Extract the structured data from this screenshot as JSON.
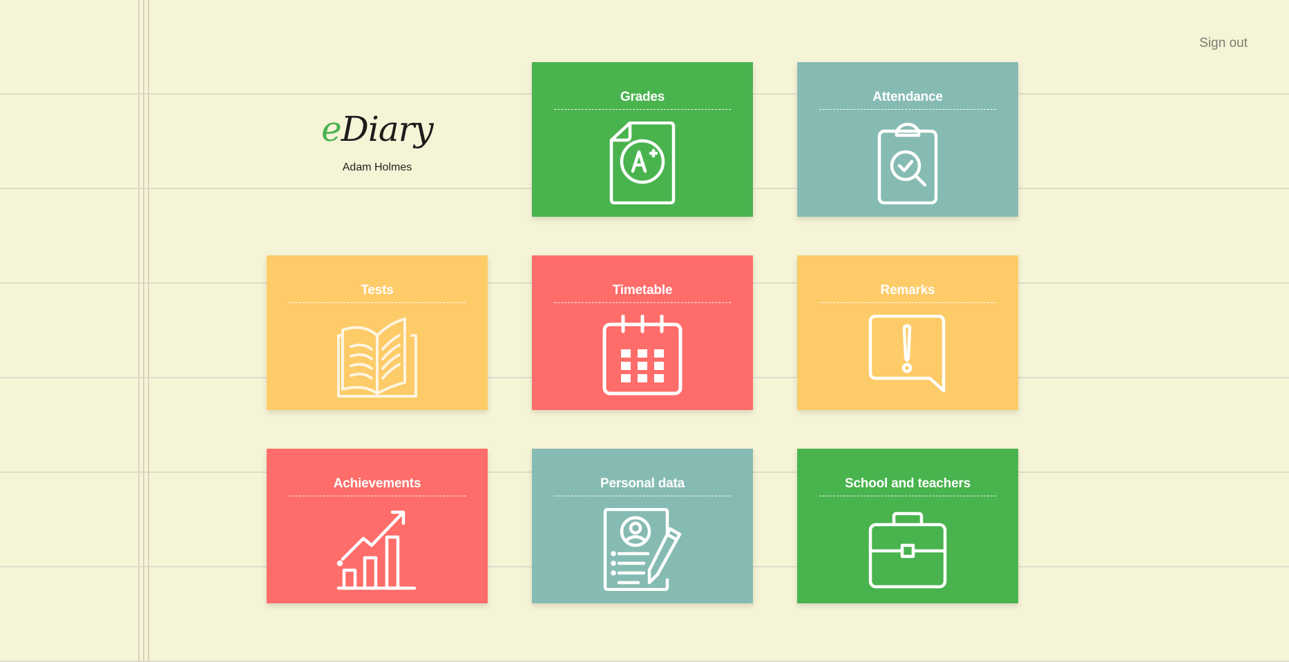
{
  "header": {
    "signout_label": "Sign out"
  },
  "brand": {
    "logo_e": "e",
    "logo_rest": "Diary",
    "user_name": "Adam Holmes"
  },
  "colors": {
    "green": "#49b34e",
    "teal": "#86bbb3",
    "yellow": "#fdcb68",
    "red": "#fe6d6a",
    "background": "#f6f4d6"
  },
  "tiles": [
    {
      "label": "Grades",
      "icon": "grade-a-plus-icon",
      "color": "#49b34e"
    },
    {
      "label": "Attendance",
      "icon": "clipboard-search-icon",
      "color": "#86bbb3"
    },
    {
      "label": "Tests",
      "icon": "open-book-icon",
      "color": "#fdcb68"
    },
    {
      "label": "Timetable",
      "icon": "calendar-icon",
      "color": "#fe6d6a"
    },
    {
      "label": "Remarks",
      "icon": "exclamation-speech-bubble-icon",
      "color": "#fdcb68"
    },
    {
      "label": "Achievements",
      "icon": "growth-chart-icon",
      "color": "#fe6d6a"
    },
    {
      "label": "Personal data",
      "icon": "profile-document-pen-icon",
      "color": "#86bbb3"
    },
    {
      "label": "School and teachers",
      "icon": "briefcase-icon",
      "color": "#49b34e"
    }
  ]
}
